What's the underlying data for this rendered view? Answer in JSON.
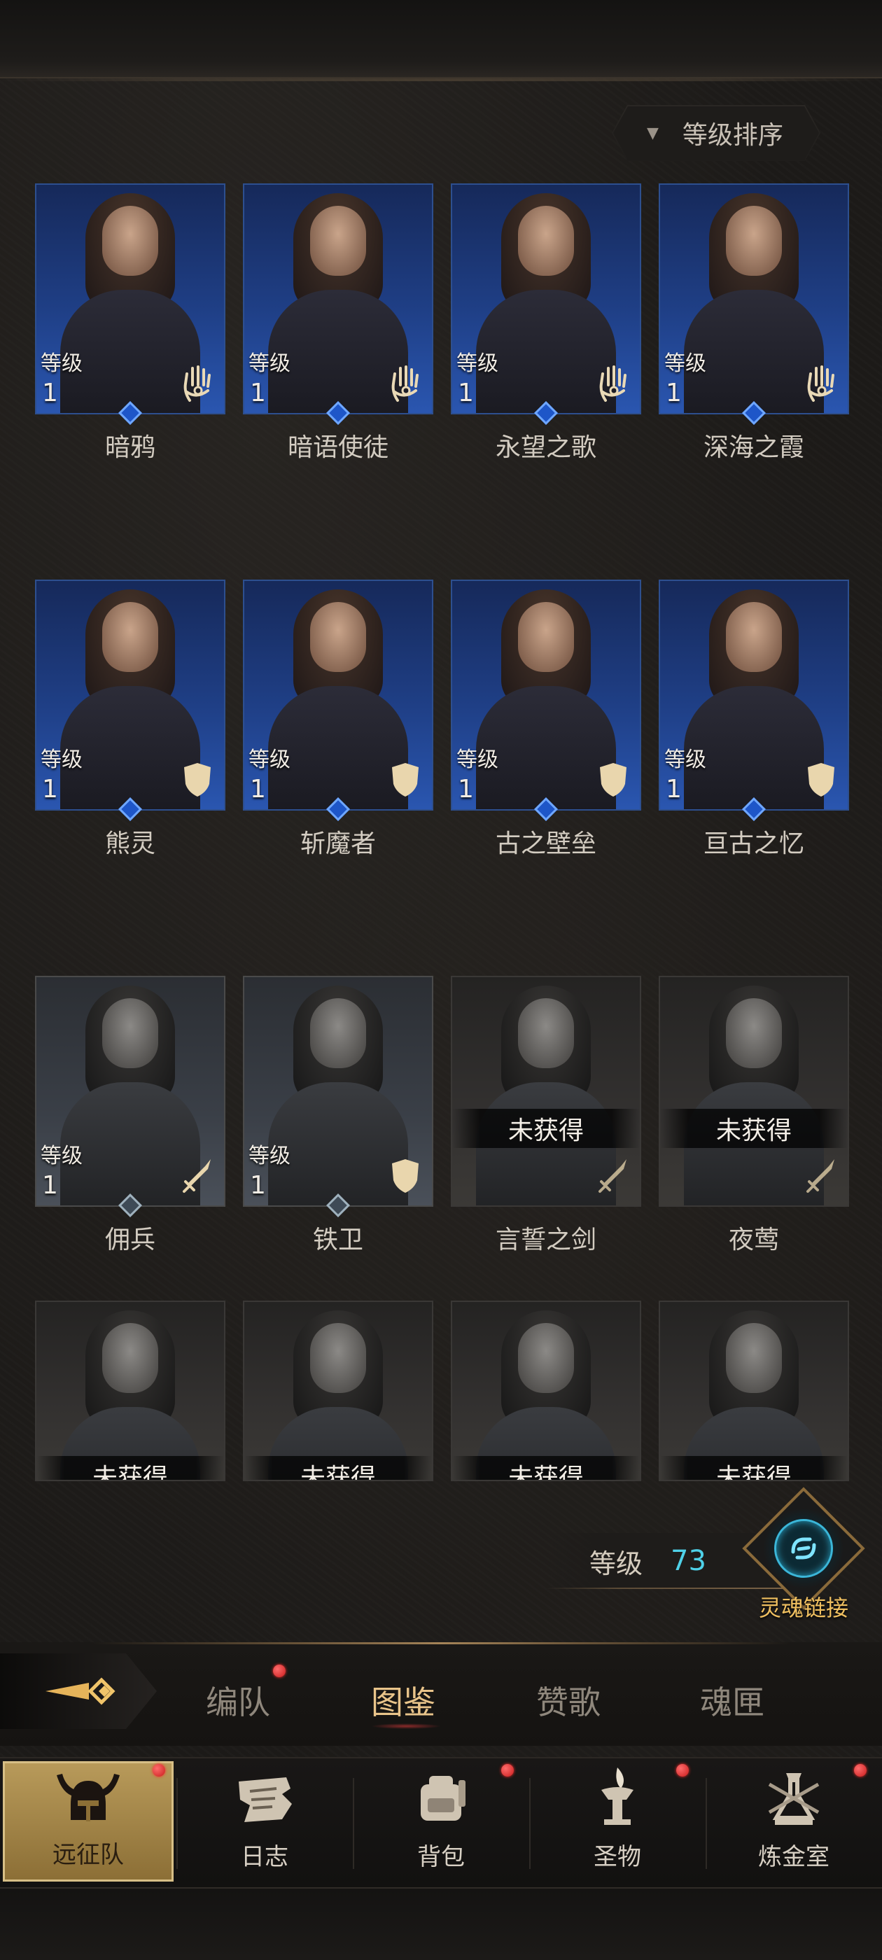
{
  "sort": {
    "label": "等级排序",
    "arrow": "▼"
  },
  "level_label": "等级",
  "heroes": [
    {
      "name": "暗鸦",
      "state": "owned",
      "level": "1",
      "class_icon": "hand-icon"
    },
    {
      "name": "暗语使徒",
      "state": "owned",
      "level": "1",
      "class_icon": "hand-icon"
    },
    {
      "name": "永望之歌",
      "state": "owned",
      "level": "1",
      "class_icon": "hand-icon"
    },
    {
      "name": "深海之霞",
      "state": "owned",
      "level": "1",
      "class_icon": "hand-icon"
    },
    {
      "name": "熊灵",
      "state": "owned",
      "level": "1",
      "class_icon": "shield-icon"
    },
    {
      "name": "斩魔者",
      "state": "owned",
      "level": "1",
      "class_icon": "shield-icon"
    },
    {
      "name": "古之壁垒",
      "state": "owned",
      "level": "1",
      "class_icon": "shield-icon"
    },
    {
      "name": "亘古之忆",
      "state": "owned",
      "level": "1",
      "class_icon": "shield-icon"
    },
    {
      "name": "佣兵",
      "state": "owned-gray",
      "level": "1",
      "class_icon": "sword-icon"
    },
    {
      "name": "铁卫",
      "state": "owned-gray",
      "level": "1",
      "class_icon": "shield-icon"
    },
    {
      "name": "言誓之剑",
      "state": "locked",
      "locked_text": "未获得",
      "class_icon": "sword-icon"
    },
    {
      "name": "夜莺",
      "state": "locked",
      "locked_text": "未获得",
      "class_icon": "sword-icon"
    },
    {
      "name": "",
      "state": "locked",
      "locked_text": "未获得"
    },
    {
      "name": "",
      "state": "locked",
      "locked_text": "未获得"
    },
    {
      "name": "",
      "state": "locked",
      "locked_text": "未获得"
    },
    {
      "name": "",
      "state": "locked",
      "locked_text": "未获得"
    }
  ],
  "player_level": {
    "label": "等级",
    "value": "73"
  },
  "soul_link": {
    "label": "灵魂链接",
    "icon": "soul-link-icon"
  },
  "subtabs": [
    {
      "label": "编队",
      "badge": true
    },
    {
      "label": "图鉴",
      "active": true
    },
    {
      "label": "赞歌"
    },
    {
      "label": "魂匣"
    }
  ],
  "nav": [
    {
      "label": "远征队",
      "icon": "viking-helmet-icon",
      "active": true,
      "badge": true
    },
    {
      "label": "日志",
      "icon": "scroll-icon"
    },
    {
      "label": "背包",
      "icon": "backpack-icon",
      "badge": true
    },
    {
      "label": "圣物",
      "icon": "torch-icon",
      "badge": true
    },
    {
      "label": "炼金室",
      "icon": "alchemy-icon",
      "badge": true
    }
  ],
  "colors": {
    "owned_frame": "#2d4f8f",
    "accent_gold": "#e9c48a",
    "level_cyan": "#4fd1e8",
    "badge_red": "#e22a2a"
  }
}
